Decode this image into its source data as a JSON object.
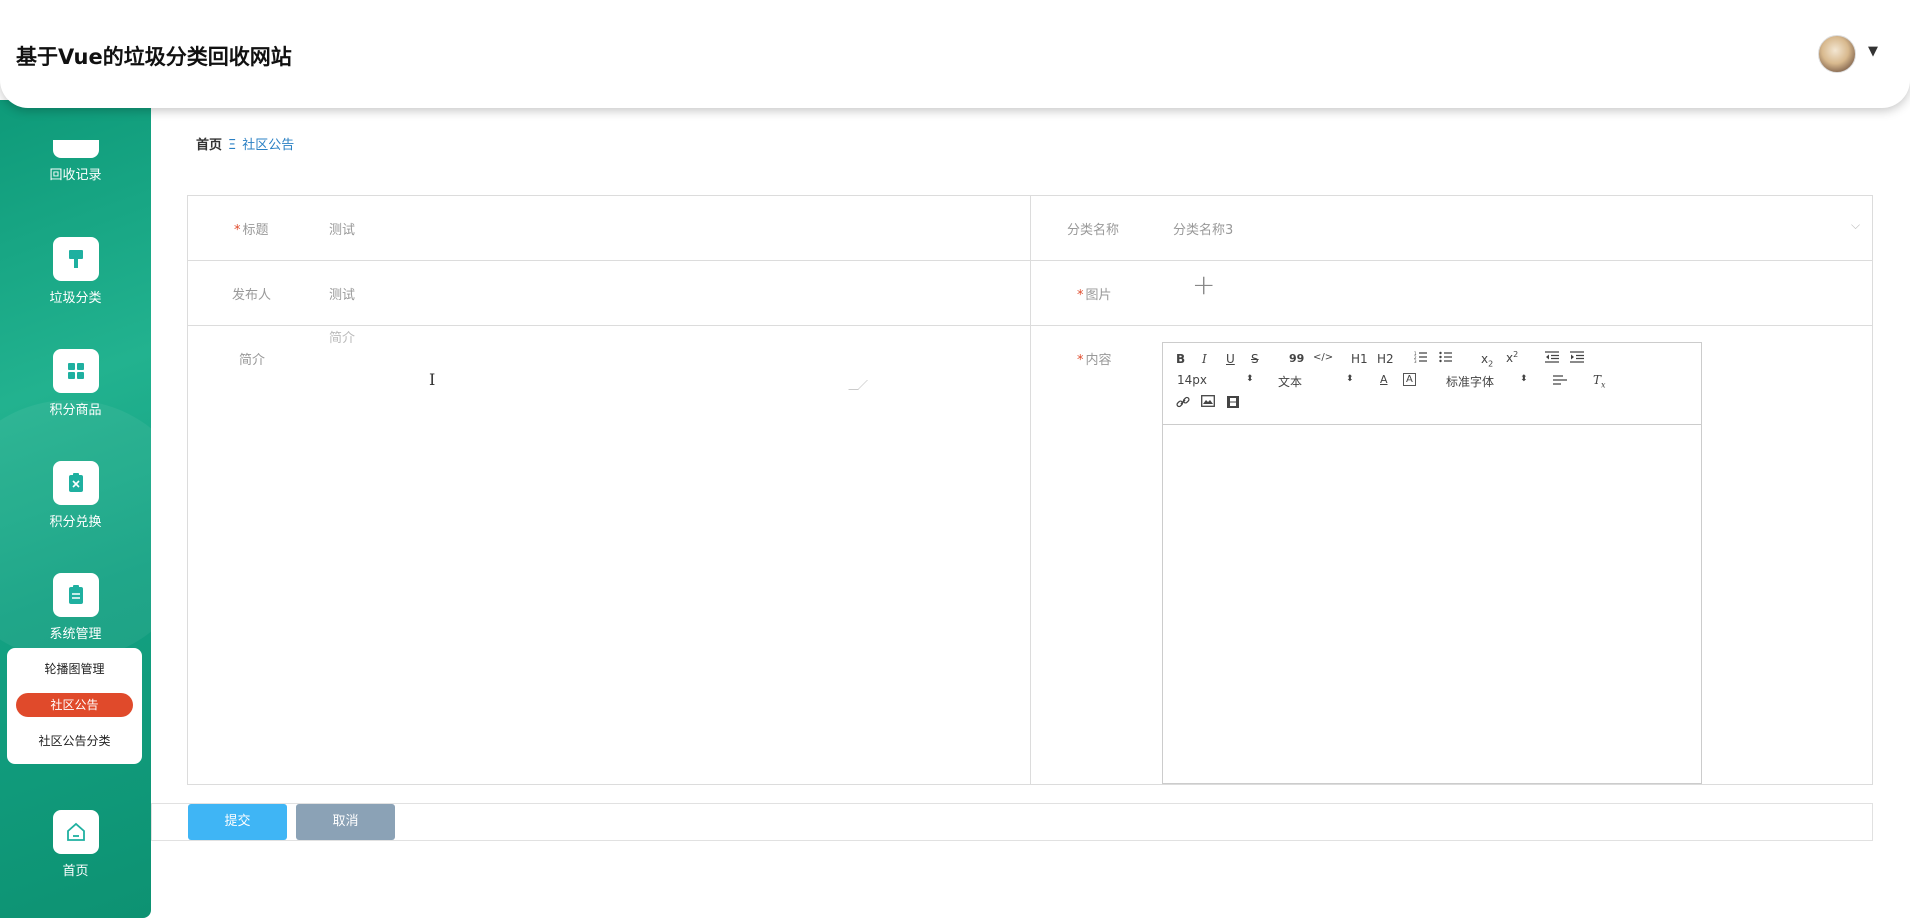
{
  "app": {
    "title": "基于Vue的垃圾分类回收网站"
  },
  "sidebar": {
    "items": [
      {
        "label": "回收记录",
        "icon": "clipboard-icon"
      },
      {
        "label": "垃圾分类",
        "icon": "brush-icon"
      },
      {
        "label": "积分商品",
        "icon": "grid-icon"
      },
      {
        "label": "积分兑换",
        "icon": "exchange-icon"
      },
      {
        "label": "系统管理",
        "icon": "document-icon"
      },
      {
        "label": "首页",
        "icon": "home-icon"
      }
    ],
    "submenu": [
      "轮播图管理",
      "社区公告",
      "社区公告分类"
    ]
  },
  "breadcrumb": {
    "home": "首页",
    "separator": "Ξ",
    "current": "社区公告"
  },
  "form": {
    "title_label": "标题",
    "title_value": "测试",
    "category_label": "分类名称",
    "category_value": "分类名称3",
    "publisher_label": "发布人",
    "publisher_value": "测试",
    "image_label": "图片",
    "summary_label": "简介",
    "summary_placeholder": "简介",
    "content_label": "内容",
    "required_mark": "*"
  },
  "editor": {
    "font_size": "14px",
    "header_select": "文本",
    "font_family": "标准字体",
    "buttons": [
      "B",
      "I",
      "U",
      "S",
      "99",
      "</>",
      "H1",
      "H2",
      "ol",
      "ul",
      "x2",
      "x2",
      "outdent",
      "indent",
      "A",
      "A",
      "align",
      "Tx",
      "link",
      "image",
      "video"
    ]
  },
  "actions": {
    "submit": "提交",
    "cancel": "取消"
  },
  "colors": {
    "accent": "#3fb5f5",
    "sidebar": "#13a182",
    "active": "#e04a2b"
  }
}
